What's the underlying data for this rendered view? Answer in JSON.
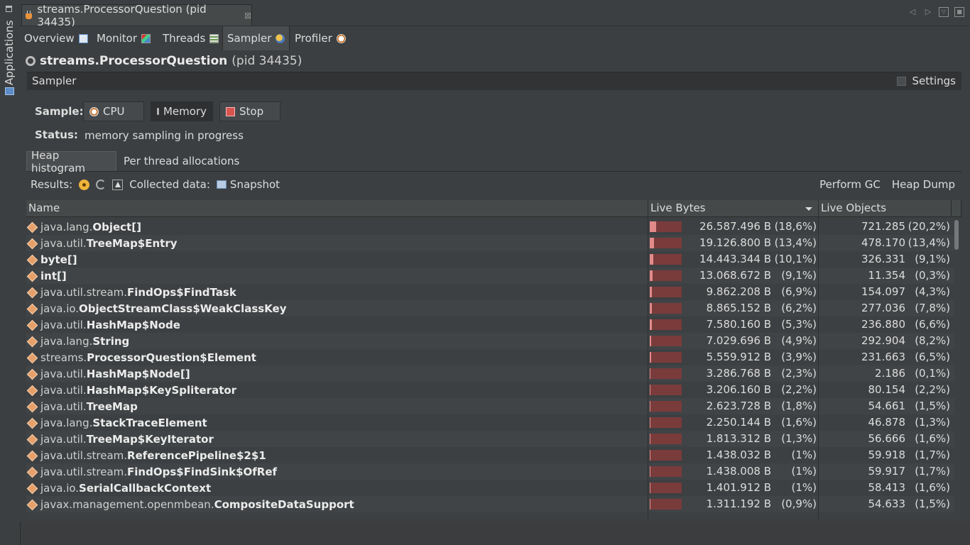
{
  "rail": {
    "label": "Applications"
  },
  "window_tab": {
    "title": "streams.ProcessorQuestion (pid 34435)",
    "close": "⊠"
  },
  "view_tabs": [
    {
      "label": "Overview"
    },
    {
      "label": "Monitor"
    },
    {
      "label": "Threads"
    },
    {
      "label": "Sampler"
    },
    {
      "label": "Profiler"
    }
  ],
  "app_title": {
    "name": "streams.ProcessorQuestion",
    "pid": "(pid 34435)"
  },
  "sampler": {
    "section": "Sampler",
    "settings": "Settings"
  },
  "sample": {
    "label": "Sample:",
    "cpu": "CPU",
    "memory": "Memory",
    "stop": "Stop"
  },
  "status": {
    "label": "Status:",
    "value": "memory sampling in progress"
  },
  "subtabs": [
    {
      "label": "Heap histogram"
    },
    {
      "label": "Per thread allocations"
    }
  ],
  "results": {
    "label": "Results:",
    "collected": "Collected data:",
    "snapshot": "Snapshot",
    "gc": "Perform GC",
    "heapdump": "Heap Dump"
  },
  "table": {
    "headers": {
      "name": "Name",
      "bytes": "Live Bytes",
      "objects": "Live Objects"
    },
    "rows": [
      {
        "pkg": "java.lang.",
        "cls": "Object[]",
        "bytes": "26.587.496 B",
        "bytes_pct": "(18,6%)",
        "objects": "721.285",
        "objects_pct": "(20,2%)",
        "frac": 0.186
      },
      {
        "pkg": "java.util.",
        "cls": "TreeMap$Entry",
        "bytes": "19.126.800 B",
        "bytes_pct": "(13,4%)",
        "objects": "478.170",
        "objects_pct": "(13,4%)",
        "frac": 0.134
      },
      {
        "pkg": "",
        "cls": "byte[]",
        "bytes": "14.443.344 B",
        "bytes_pct": "(10,1%)",
        "objects": "326.331",
        "objects_pct": "(9,1%)",
        "frac": 0.101
      },
      {
        "pkg": "",
        "cls": "int[]",
        "bytes": "13.068.672 B",
        "bytes_pct": "(9,1%)",
        "objects": "11.354",
        "objects_pct": "(0,3%)",
        "frac": 0.091
      },
      {
        "pkg": "java.util.stream.",
        "cls": "FindOps$FindTask",
        "bytes": "9.862.208 B",
        "bytes_pct": "(6,9%)",
        "objects": "154.097",
        "objects_pct": "(4,3%)",
        "frac": 0.069
      },
      {
        "pkg": "java.io.",
        "cls": "ObjectStreamClass$WeakClassKey",
        "bytes": "8.865.152 B",
        "bytes_pct": "(6,2%)",
        "objects": "277.036",
        "objects_pct": "(7,8%)",
        "frac": 0.062
      },
      {
        "pkg": "java.util.",
        "cls": "HashMap$Node",
        "bytes": "7.580.160 B",
        "bytes_pct": "(5,3%)",
        "objects": "236.880",
        "objects_pct": "(6,6%)",
        "frac": 0.053
      },
      {
        "pkg": "java.lang.",
        "cls": "String",
        "bytes": "7.029.696 B",
        "bytes_pct": "(4,9%)",
        "objects": "292.904",
        "objects_pct": "(8,2%)",
        "frac": 0.049
      },
      {
        "pkg": "streams.",
        "cls": "ProcessorQuestion$Element",
        "bytes": "5.559.912 B",
        "bytes_pct": "(3,9%)",
        "objects": "231.663",
        "objects_pct": "(6,5%)",
        "frac": 0.039
      },
      {
        "pkg": "java.util.",
        "cls": "HashMap$Node[]",
        "bytes": "3.286.768 B",
        "bytes_pct": "(2,3%)",
        "objects": "2.186",
        "objects_pct": "(0,1%)",
        "frac": 0.023
      },
      {
        "pkg": "java.util.",
        "cls": "HashMap$KeySpliterator",
        "bytes": "3.206.160 B",
        "bytes_pct": "(2,2%)",
        "objects": "80.154",
        "objects_pct": "(2,2%)",
        "frac": 0.022
      },
      {
        "pkg": "java.util.",
        "cls": "TreeMap",
        "bytes": "2.623.728 B",
        "bytes_pct": "(1,8%)",
        "objects": "54.661",
        "objects_pct": "(1,5%)",
        "frac": 0.018
      },
      {
        "pkg": "java.lang.",
        "cls": "StackTraceElement",
        "bytes": "2.250.144 B",
        "bytes_pct": "(1,6%)",
        "objects": "46.878",
        "objects_pct": "(1,3%)",
        "frac": 0.016
      },
      {
        "pkg": "java.util.",
        "cls": "TreeMap$KeyIterator",
        "bytes": "1.813.312 B",
        "bytes_pct": "(1,3%)",
        "objects": "56.666",
        "objects_pct": "(1,6%)",
        "frac": 0.013
      },
      {
        "pkg": "java.util.stream.",
        "cls": "ReferencePipeline$2$1",
        "bytes": "1.438.032 B",
        "bytes_pct": "(1%)",
        "objects": "59.918",
        "objects_pct": "(1,7%)",
        "frac": 0.01
      },
      {
        "pkg": "java.util.stream.",
        "cls": "FindOps$FindSink$OfRef",
        "bytes": "1.438.008 B",
        "bytes_pct": "(1%)",
        "objects": "59.917",
        "objects_pct": "(1,7%)",
        "frac": 0.01
      },
      {
        "pkg": "java.io.",
        "cls": "SerialCallbackContext",
        "bytes": "1.401.912 B",
        "bytes_pct": "(1%)",
        "objects": "58.413",
        "objects_pct": "(1,6%)",
        "frac": 0.01
      },
      {
        "pkg": "javax.management.openmbean.",
        "cls": "CompositeDataSupport",
        "bytes": "1.311.192 B",
        "bytes_pct": "(0,9%)",
        "objects": "54.633",
        "objects_pct": "(1,5%)",
        "frac": 0.009
      }
    ]
  }
}
